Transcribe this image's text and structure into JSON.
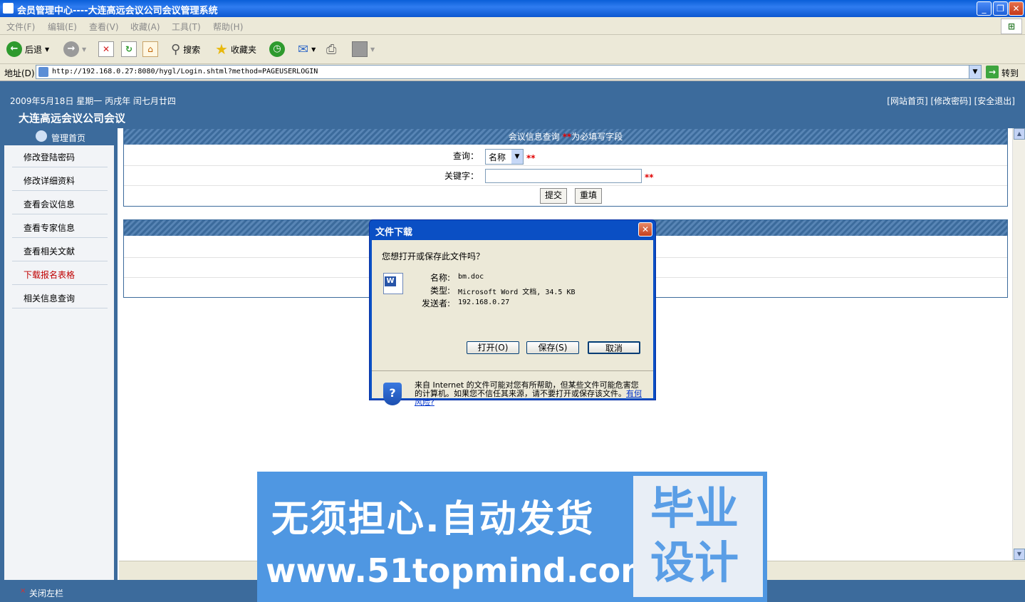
{
  "window": {
    "title": "会员管理中心----大连高远会议公司会议管理系统"
  },
  "menu": [
    "文件(F)",
    "编辑(E)",
    "查看(V)",
    "收藏(A)",
    "工具(T)",
    "帮助(H)"
  ],
  "toolbar": {
    "back": "后退",
    "search": "搜索",
    "favorites": "收藏夹"
  },
  "address": {
    "label": "地址(D)",
    "url": "http://192.168.0.27:8080/hygl/Login.shtml?method=PAGEUSERLOGIN",
    "go": "转到"
  },
  "header": {
    "date": "2009年5月18日  星期一  丙戌年  闰七月廿四",
    "title": "大连高远会议公司会议",
    "links": "[网站首页] [修改密码] [安全退出]"
  },
  "sidebar": {
    "title": "管理首页",
    "items": [
      "修改登陆密码",
      "修改详细资料",
      "查看会议信息",
      "查看专家信息",
      "查看相关文献",
      "下载报名表格",
      "相关信息查询"
    ],
    "active_index": 5
  },
  "query_panel": {
    "title": "会议信息查询",
    "req_mark": "**",
    "req_text": "为必填写字段",
    "query_label": "查询：",
    "select_value": "名称",
    "keyword_label": "关键字：",
    "submit": "提交",
    "reset": "重填"
  },
  "dialog": {
    "title": "文件下载",
    "question": "您想打开或保存此文件吗？",
    "name_label": "名称:",
    "name_value": "bm.doc",
    "type_label": "类型:",
    "type_value": "Microsoft Word 文档, 34.5 KB",
    "from_label": "发送者:",
    "from_value": "192.168.0.27",
    "open": "打开(O)",
    "save": "保存(S)",
    "cancel": "取消",
    "warning": "来自 Internet 的文件可能对您有所帮助，但某些文件可能危害您的计算机。如果您不信任其来源，请不要打开或保存该文件。",
    "risk_link": "有何风险?"
  },
  "status": {
    "close_left": "关闭左栏"
  },
  "banner": {
    "line1": "无须担心.自动发货",
    "line2": "www.51topmind.com",
    "box": "毕业设计"
  }
}
